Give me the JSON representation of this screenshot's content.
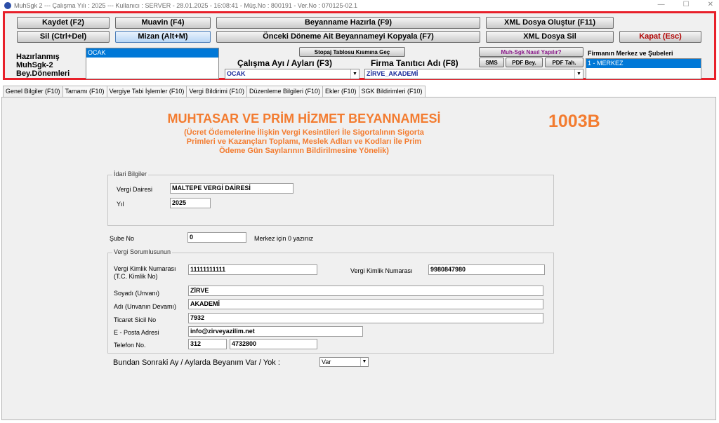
{
  "titlebar": {
    "app": "MuhSgk 2",
    "year": "--- Çalışma Yılı : 2025",
    "user": "--- Kullanıcı : SERVER - 28.01.2025 - 16:08:41 - Müş.No : 800191 - Ver.No : 070125-02.1",
    "minimize": "—",
    "maximize": "☐",
    "close": "✕"
  },
  "toolbar": {
    "kaydet": "Kaydet (F2)",
    "muavin": "Muavin (F4)",
    "beyanname_hazirla": "Beyanname Hazırla (F9)",
    "xml_olustur": "XML Dosya Oluştur (F11)",
    "sil": "Sil (Ctrl+Del)",
    "mizan": "Mizan (Alt+M)",
    "onceki_donem": "Önceki Döneme Ait Beyannameyi Kopyala (F7)",
    "xml_sil": "XML Dosya Sil",
    "kapat": "Kapat (Esc)",
    "stopaj": "Stopaj Tablosu Kısmına Geç",
    "nasil": "Muh-Sgk Nasıl Yapılır?",
    "sms": "SMS",
    "pdf_bey": "PDF Bey.",
    "pdf_tah": "PDF Tah."
  },
  "left_label": {
    "line1": "Hazırlanmış",
    "line2": "MuhSgk-2",
    "line3": "Bey.Dönemleri"
  },
  "donemler": [
    "OCAK"
  ],
  "calisma_ayi": {
    "label": "Çalışma Ayı / Ayları (F3)",
    "value": "OCAK"
  },
  "firma": {
    "label": "Firma Tanıtıcı Adı (F8)",
    "value": "ZİRVE_AKADEMİ"
  },
  "subeler": {
    "label": "Firmanın Merkez ve Şubeleri",
    "items": [
      "1 - MERKEZ"
    ]
  },
  "tabs": [
    "Genel Bilgiler (F10)",
    "Tamamı (F10)",
    "Vergiye Tabi İşlemler (F10)",
    "Vergi Bildirimi (F10)",
    "Düzenleme Bilgileri (F10)",
    "Ekler (F10)",
    "SGK Bildirimleri (F10)"
  ],
  "header": {
    "title": "MUHTASAR VE PRİM HİZMET BEYANNAMESİ",
    "subtitle": "(Ücret Ödemelerine İlişkin Vergi Kesintileri İle Sigortalının Sigorta Primleri ve Kazançları Toplamı, Meslek Adları ve Kodları İle Prim Ödeme Gün Sayılarının Bildirilmesine Yönelik)",
    "code": "1003B"
  },
  "idari": {
    "title": "İdari Bilgiler",
    "vergi_dairesi_label": "Vergi Dairesi",
    "vergi_dairesi": "MALTEPE VERGİ DAİRESİ",
    "yil_label": "Yıl",
    "yil": "2025"
  },
  "sube": {
    "label": "Şube No",
    "value": "0",
    "hint": "Merkez için 0 yazınız"
  },
  "sorumlu": {
    "title": "Vergi Sorumlusunun",
    "tckn_label1": "Vergi Kimlik Numarası",
    "tckn_label2": "(T.C. Kimlik No)",
    "tckn": "11111111111",
    "vkn_label": "Vergi Kimlik Numarası",
    "vkn": "9980847980",
    "soyadi_label": "Soyadı (Unvanı)",
    "soyadi": "ZİRVE",
    "adi_label": "Adı (Unvanın Devamı)",
    "adi": "AKADEMİ",
    "ticaret_label": "Ticaret Sicil No",
    "ticaret": "7932",
    "eposta_label": "E - Posta Adresi",
    "eposta": "info@zirveyazilim.net",
    "telefon_label": "Telefon No.",
    "tel_kod": "312",
    "tel_no": "4732800"
  },
  "sonraki": {
    "label": "Bundan Sonraki Ay / Aylarda Beyanım Var / Yok :",
    "value": "Var"
  }
}
